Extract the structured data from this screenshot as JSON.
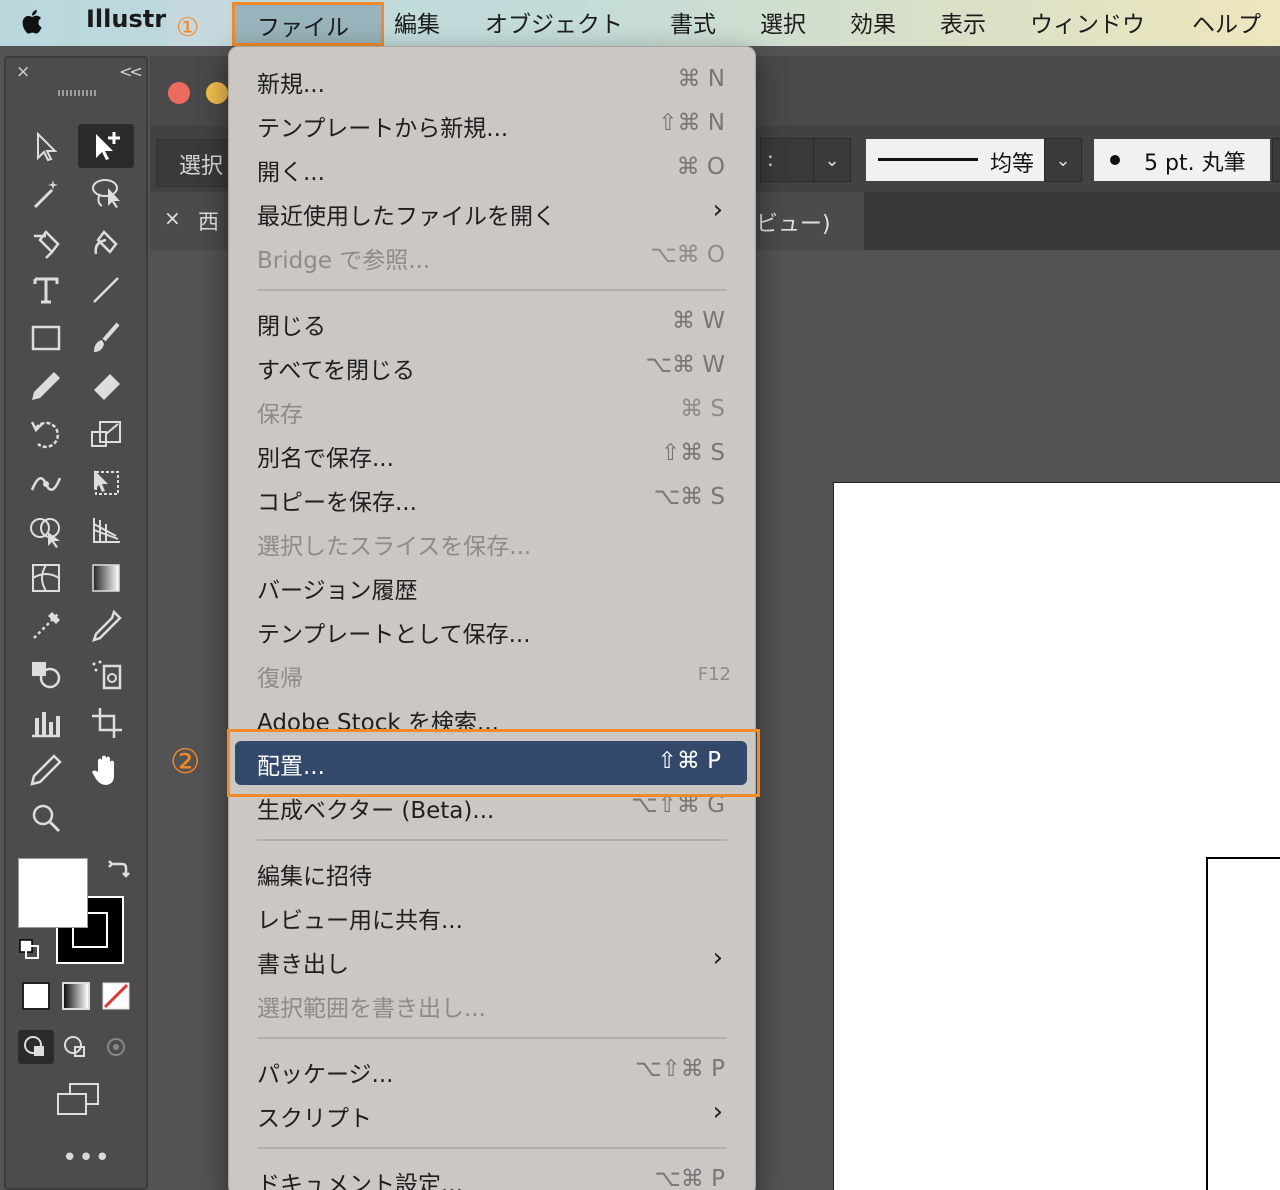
{
  "menubar": {
    "app_name": "Illustr",
    "items": [
      "ファイル",
      "編集",
      "オブジェクト",
      "書式",
      "選択",
      "効果",
      "表示",
      "ウィンドウ",
      "ヘルプ"
    ],
    "step1_marker": "①"
  },
  "tools_panel": {
    "close": "×",
    "collapse": "<<",
    "more": "•••"
  },
  "control_bar": {
    "selection_label": "選択",
    "stroke_profile": "均等",
    "brush": "5 pt. 丸筆",
    "dropdown1_partial": ":"
  },
  "document_tab": {
    "close": "×",
    "title_left": "西",
    "title_right": "ビュー)"
  },
  "file_menu": {
    "items": [
      {
        "label": "新規...",
        "shortcut": "⌘ N",
        "enabled": true
      },
      {
        "label": "テンプレートから新規...",
        "shortcut": "⇧⌘ N",
        "enabled": true
      },
      {
        "label": "開く...",
        "shortcut": "⌘ O",
        "enabled": true
      },
      {
        "label": "最近使用したファイルを開く",
        "shortcut": "›",
        "enabled": true
      },
      {
        "label": "Bridge で参照...",
        "shortcut": "⌥⌘ O",
        "enabled": false
      },
      {
        "label": "閉じる",
        "shortcut": "⌘ W",
        "enabled": true
      },
      {
        "label": "すべてを閉じる",
        "shortcut": "⌥⌘ W",
        "enabled": true
      },
      {
        "label": "保存",
        "shortcut": "⌘ S",
        "enabled": false
      },
      {
        "label": "別名で保存...",
        "shortcut": "⇧⌘ S",
        "enabled": true
      },
      {
        "label": "コピーを保存...",
        "shortcut": "⌥⌘ S",
        "enabled": true
      },
      {
        "label": "選択したスライスを保存...",
        "shortcut": "",
        "enabled": false
      },
      {
        "label": "バージョン履歴",
        "shortcut": "",
        "enabled": true
      },
      {
        "label": "テンプレートとして保存...",
        "shortcut": "",
        "enabled": true
      },
      {
        "label": "復帰",
        "shortcut": "F12",
        "enabled": false
      },
      {
        "label": "Adobe Stock を検索...",
        "shortcut": "",
        "enabled": true
      },
      {
        "label": "配置...",
        "shortcut": "⇧⌘ P",
        "enabled": true,
        "highlighted": true
      },
      {
        "label": "生成ベクター (Beta)...",
        "shortcut": "⌥⇧⌘ G",
        "enabled": true
      },
      {
        "label": "編集に招待",
        "shortcut": "",
        "enabled": true
      },
      {
        "label": "レビュー用に共有...",
        "shortcut": "",
        "enabled": true
      },
      {
        "label": "書き出し",
        "shortcut": "›",
        "enabled": true
      },
      {
        "label": "選択範囲を書き出し...",
        "shortcut": "",
        "enabled": false
      },
      {
        "label": "パッケージ...",
        "shortcut": "⌥⇧⌘ P",
        "enabled": true
      },
      {
        "label": "スクリプト",
        "shortcut": "›",
        "enabled": true
      },
      {
        "label": "ドキュメント設定...",
        "shortcut": "⌥⌘ P",
        "enabled": true
      }
    ],
    "step2_marker": "②"
  },
  "colors": {
    "highlight": "#33496b",
    "annotation": "#f28a2a",
    "menu_bg": "#cbc7c2"
  }
}
